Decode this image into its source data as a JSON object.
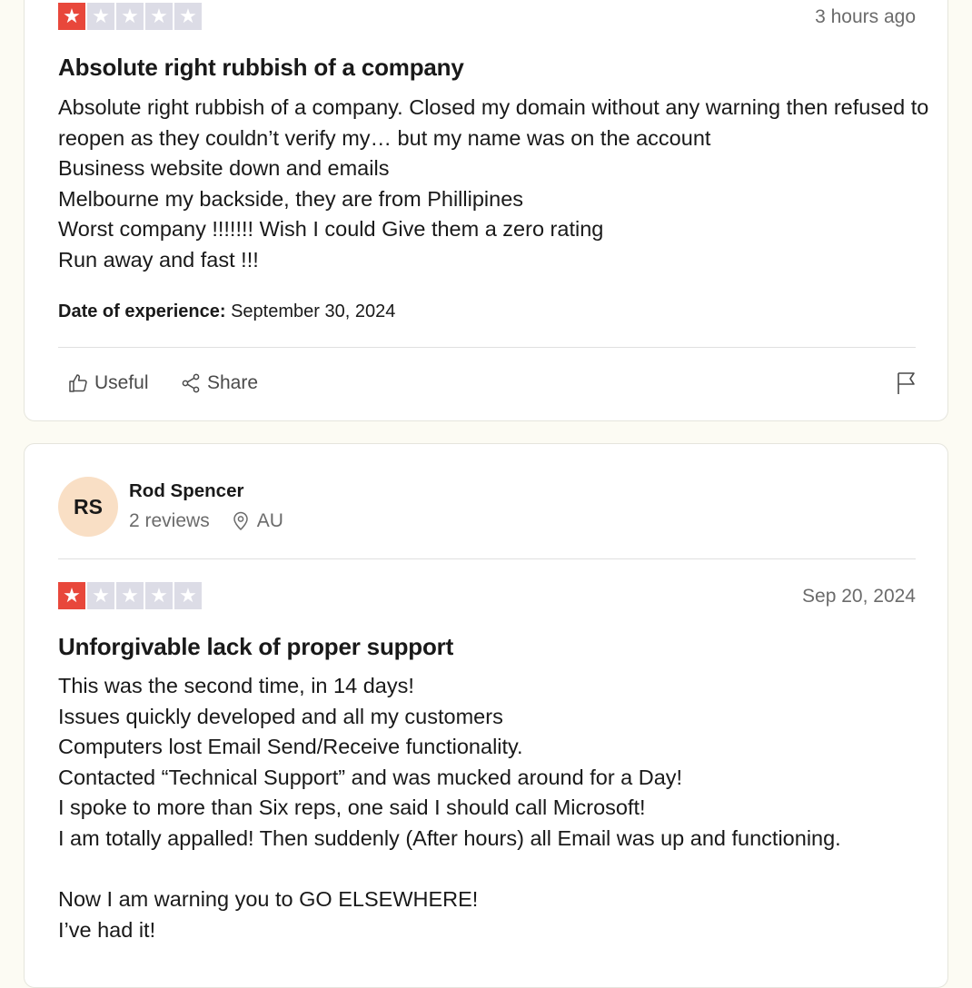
{
  "reviews": [
    {
      "rating": 1,
      "date": "3 hours ago",
      "title": "Absolute right rubbish of a company",
      "body": [
        "Absolute right rubbish of a company. Closed my domain without any warning then refused to reopen as they couldn’t verify my… but my name was on the account",
        "Business website down and emails",
        "Melbourne my backside, they are from Phillipines",
        "Worst company !!!!!!! Wish I could Give them a zero rating",
        "Run away and fast !!!"
      ],
      "experience_label": "Date of experience:",
      "experience_date": "September 30, 2024",
      "useful_label": "Useful",
      "share_label": "Share"
    },
    {
      "rating": 1,
      "reviewer": {
        "initials": "RS",
        "name": "Rod Spencer",
        "reviews": "2 reviews",
        "location": "AU"
      },
      "date": "Sep 20, 2024",
      "title": "Unforgivable lack of proper support",
      "body": [
        "This was the second time, in 14 days!",
        "Issues quickly developed and all my customers",
        "Computers lost Email Send/Receive functionality.",
        "Contacted “Technical Support” and was mucked around for a Day!",
        "I spoke to more than Six reps, one said I should call Microsoft!",
        "I am totally appalled! Then suddenly (After hours) all Email was up and functioning.",
        "",
        "Now I am warning you to GO ELSEWHERE!",
        "I’ve had it!"
      ]
    }
  ],
  "colors": {
    "star_filled": "#e8473b",
    "star_empty": "#dcdce6",
    "avatar_bg": "#f9dfc5",
    "page_bg": "#fcfbf3"
  },
  "icons": [
    "star-icon",
    "thumbs-up-icon",
    "share-icon",
    "flag-icon",
    "location-pin-icon"
  ]
}
